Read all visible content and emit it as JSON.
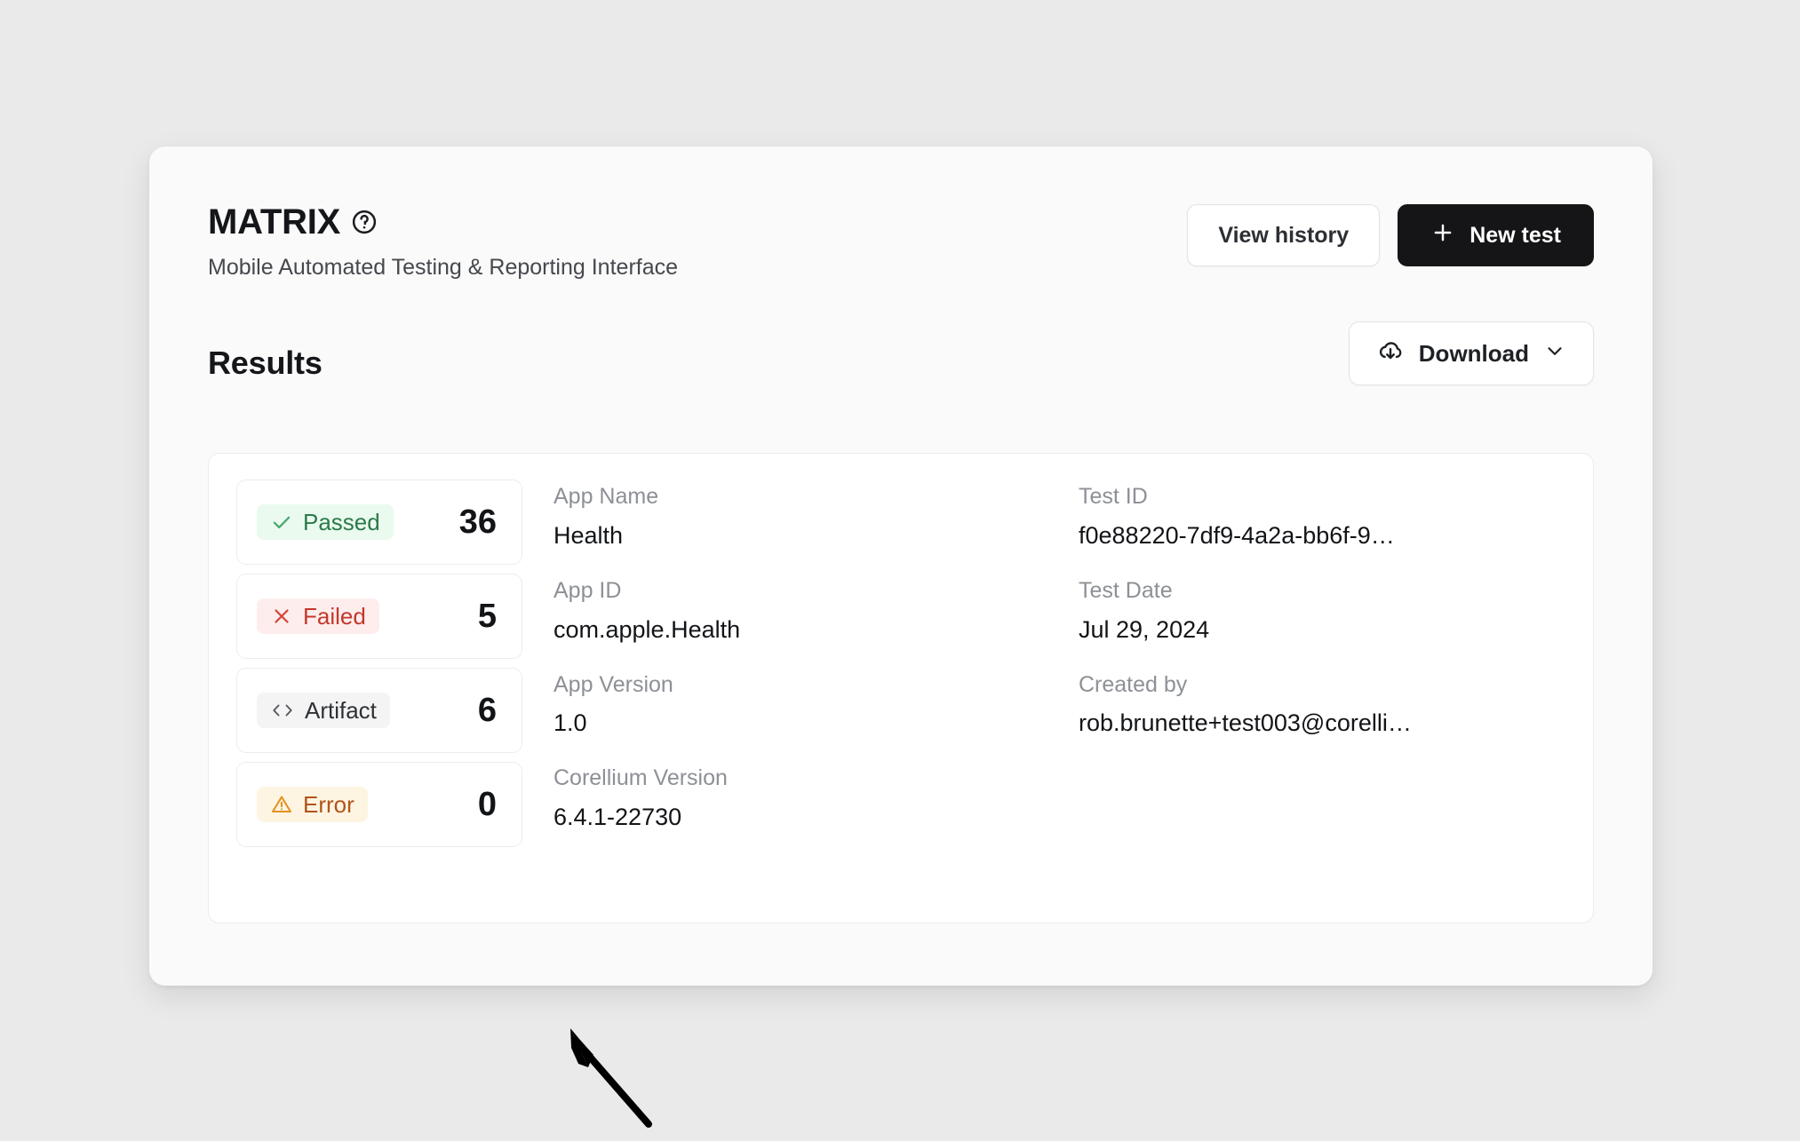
{
  "header": {
    "title": "MATRIX",
    "help_icon": "help-circle-icon",
    "subtitle": "Mobile Automated Testing & Reporting Interface",
    "view_history_label": "View history",
    "new_test_label": "New test",
    "new_test_icon": "plus-icon"
  },
  "results": {
    "section_title": "Results",
    "download_label": "Download",
    "download_icon": "cloud-download-icon",
    "download_chevron": "chevron-down-icon",
    "stats": [
      {
        "label": "Passed",
        "value": "36",
        "icon": "check-icon",
        "style": "passed"
      },
      {
        "label": "Failed",
        "value": "5",
        "icon": "x-icon",
        "style": "failed"
      },
      {
        "label": "Artifact",
        "value": "6",
        "icon": "code-icon",
        "style": "artifact"
      },
      {
        "label": "Error",
        "value": "0",
        "icon": "warning-icon",
        "style": "error"
      }
    ],
    "meta": [
      {
        "label": "App Name",
        "value": "Health"
      },
      {
        "label": "Test ID",
        "value": "f0e88220-7df9-4a2a-bb6f-9…"
      },
      {
        "label": "App ID",
        "value": "com.apple.Health"
      },
      {
        "label": "Test Date",
        "value": "Jul 29, 2024"
      },
      {
        "label": "App Version",
        "value": "1.0"
      },
      {
        "label": "Created by",
        "value": "rob.brunette+test003@corelli…"
      },
      {
        "label": "Corellium Version",
        "value": "6.4.1-22730"
      },
      {
        "label": "",
        "value": ""
      }
    ]
  },
  "annotation": {
    "pointer_icon": "arrow-pointer-annotation"
  },
  "colors": {
    "page_background": "#eaeaea",
    "card_background": "#fafafa",
    "panel_background": "#ffffff",
    "primary_button": "#151517",
    "passed_text": "#2c7a4b",
    "passed_bg": "#eafaef",
    "failed_text": "#c5372c",
    "failed_bg": "#fdeeed",
    "artifact_text": "#2e3135",
    "artifact_bg": "#f4f4f5",
    "error_text": "#b1541b",
    "error_bg": "#fdf5e2",
    "error_icon": "#e3921f"
  }
}
